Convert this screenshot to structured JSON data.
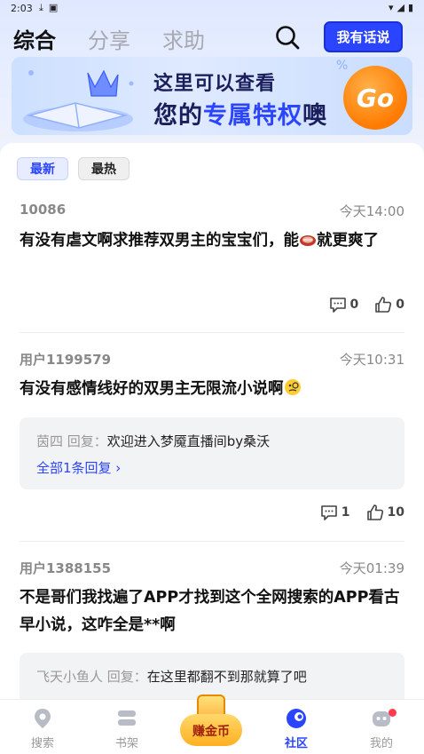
{
  "status_bar": {
    "time": "2:03"
  },
  "header": {
    "tabs": [
      {
        "label": "综合",
        "active": true
      },
      {
        "label": "分享",
        "active": false
      },
      {
        "label": "求助",
        "active": false
      }
    ],
    "post_button": "我有话说"
  },
  "banner": {
    "line1": "这里可以查看",
    "line2_prefix": "您的",
    "line2_highlight": "专属特权",
    "line2_suffix": "噢",
    "go_label": "Go"
  },
  "filters": [
    {
      "label": "最新",
      "active": true
    },
    {
      "label": "最热",
      "active": false
    }
  ],
  "posts": [
    {
      "user": "10086",
      "time": "今天14:00",
      "body_part1": "有没有虐文啊求推荐双男主的宝宝们，能",
      "body_part2": "就更爽了",
      "comments": "0",
      "likes": "0"
    },
    {
      "user": "用户1199579",
      "time": "今天10:31",
      "body": "有没有感情线好的双男主无限流小说啊",
      "reply_author": "茵四 回复：",
      "reply_text": "欢迎进入梦魇直播间by桑沃",
      "reply_more": "全部1条回复 ›",
      "comments": "1",
      "likes": "10"
    },
    {
      "user": "用户1388155",
      "time": "今天01:39",
      "body": "不是哥们我找遍了APP才找到这个全网搜索的APP看古早小说，这咋全是**啊",
      "reply_author": "飞天小鱼人 回复：",
      "reply_text": "在这里都翻不到那就算了吧"
    }
  ],
  "bottom_nav": [
    {
      "label": "搜索"
    },
    {
      "label": "书架"
    },
    {
      "label": "赚金币"
    },
    {
      "label": "社区"
    },
    {
      "label": "我的"
    }
  ],
  "colors": {
    "accent": "#2b44ff",
    "badge": "#ff3b4e"
  }
}
